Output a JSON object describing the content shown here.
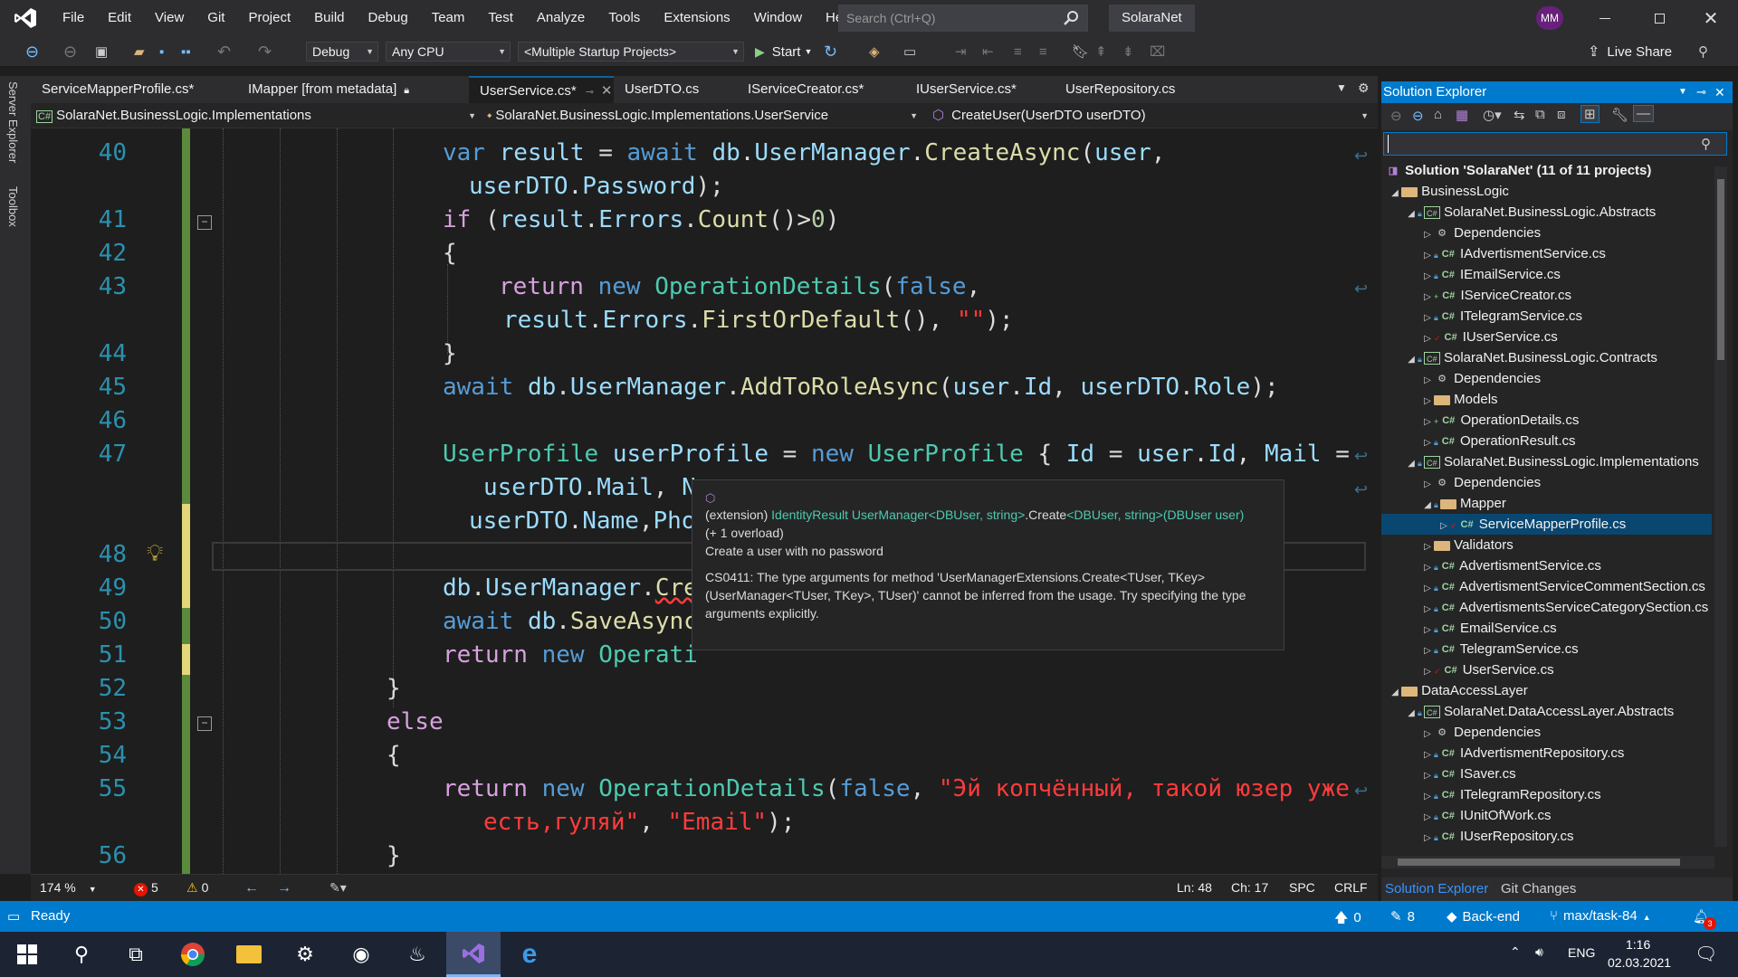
{
  "menu": [
    "File",
    "Edit",
    "View",
    "Git",
    "Project",
    "Build",
    "Debug",
    "Team",
    "Test",
    "Analyze",
    "Tools",
    "Extensions",
    "Window",
    "Help"
  ],
  "search": {
    "placeholder": "Search (Ctrl+Q)"
  },
  "solution_name": "SolaraNet",
  "user_initials": "MM",
  "toolbar": {
    "config": "Debug",
    "platform": "Any CPU",
    "startup": "<Multiple Startup Projects>",
    "start_label": "Start",
    "live_share": "Live Share"
  },
  "left_strip": {
    "server_explorer": "Server Explorer",
    "toolbox": "Toolbox"
  },
  "tabs": [
    "ServiceMapperProfile.cs*",
    "IMapper [from metadata]",
    "UserService.cs*",
    "UserDTO.cs",
    "IServiceCreator.cs*",
    "IUserService.cs*",
    "UserRepository.cs"
  ],
  "nav": {
    "project": "SolaraNet.BusinessLogic.Implementations",
    "type": "SolaraNet.BusinessLogic.Implementations.UserService",
    "member": "CreateUser(UserDTO userDTO)"
  },
  "line_numbers": [
    "40",
    "41",
    "42",
    "43",
    "44",
    "45",
    "46",
    "47",
    "48",
    "49",
    "50",
    "51",
    "52",
    "53",
    "54",
    "55",
    "56"
  ],
  "tooltip": {
    "prefix": "(extension) ",
    "sig_type": "IdentityResult UserManager",
    "sig_generic": "<DBUser, string>",
    "sig_method": ".Create",
    "sig_args": "<DBUser, string>(DBUser user)",
    "overload": "(+ 1 overload)",
    "summary": "Create a user with no password",
    "error": "CS0411: The type arguments for method 'UserManagerExtensions.Create<TUser, TKey>(UserManager<TUser, TKey>, TUser)' cannot be inferred from the usage. Try specifying the type arguments explicitly."
  },
  "editor_status": {
    "zoom": "174 %",
    "errors": "5",
    "warnings": "0",
    "ln": "Ln: 48",
    "ch": "Ch: 17",
    "spc": "SPC",
    "crlf": "CRLF"
  },
  "solution_explorer": {
    "title": "Solution Explorer",
    "root": "Solution 'SolaraNet' (11 of 11 projects)",
    "items": [
      {
        "label": "BusinessLogic"
      },
      {
        "label": "SolaraNet.BusinessLogic.Abstracts"
      },
      {
        "label": "Dependencies"
      },
      {
        "label": "IAdvertismentService.cs"
      },
      {
        "label": "IEmailService.cs"
      },
      {
        "label": "IServiceCreator.cs"
      },
      {
        "label": "ITelegramService.cs"
      },
      {
        "label": "IUserService.cs"
      },
      {
        "label": "SolaraNet.BusinessLogic.Contracts"
      },
      {
        "label": "Dependencies"
      },
      {
        "label": "Models"
      },
      {
        "label": "OperationDetails.cs"
      },
      {
        "label": "OperationResult.cs"
      },
      {
        "label": "SolaraNet.BusinessLogic.Implementations"
      },
      {
        "label": "Dependencies"
      },
      {
        "label": "Mapper"
      },
      {
        "label": "ServiceMapperProfile.cs"
      },
      {
        "label": "Validators"
      },
      {
        "label": "AdvertismentService.cs"
      },
      {
        "label": "AdvertismentServiceCommentSection.cs"
      },
      {
        "label": "AdvertismentsServiceCategorySection.cs"
      },
      {
        "label": "EmailService.cs"
      },
      {
        "label": "TelegramService.cs"
      },
      {
        "label": "UserService.cs"
      },
      {
        "label": "DataAccessLayer"
      },
      {
        "label": "SolaraNet.DataAccessLayer.Abstracts"
      },
      {
        "label": "Dependencies"
      },
      {
        "label": "IAdvertismentRepository.cs"
      },
      {
        "label": "ISaver.cs"
      },
      {
        "label": "ITelegramRepository.cs"
      },
      {
        "label": "IUnitOfWork.cs"
      },
      {
        "label": "IUserRepository.cs"
      }
    ],
    "bottom_tabs": [
      "Solution Explorer",
      "Git Changes"
    ]
  },
  "statusbar": {
    "ready": "Ready",
    "up": "0",
    "pencil": "8",
    "repo": "Back-end",
    "branch": "max/task-84",
    "notif": "3"
  },
  "taskbar": {
    "lang": "ENG",
    "time": "1:16",
    "date": "02.03.2021"
  },
  "colors": {
    "accent": "#007acc",
    "keyword": "#569cd6",
    "type": "#4ec9b0",
    "method": "#dcdcaa",
    "string_red": "#ff3b3b"
  }
}
